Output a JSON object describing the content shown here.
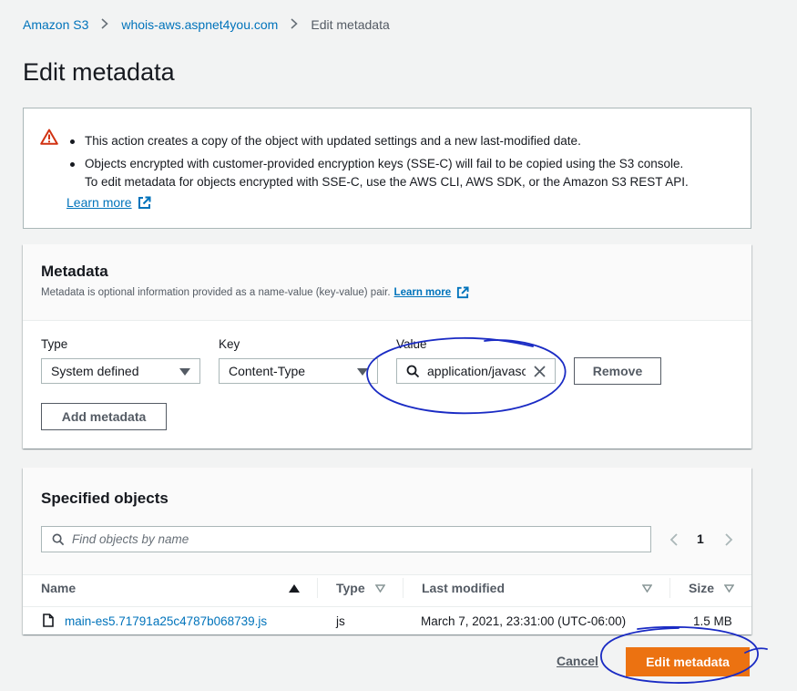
{
  "breadcrumb": {
    "items": [
      "Amazon S3",
      "whois-aws.aspnet4you.com"
    ],
    "current": "Edit metadata"
  },
  "page": {
    "title": "Edit metadata"
  },
  "warning": {
    "bullets": [
      "This action creates a copy of the object with updated settings and a new last-modified date.",
      "Objects encrypted with customer-provided encryption keys (SSE-C) will fail to be copied using the S3 console.",
      "To edit metadata for objects encrypted with SSE-C, use the AWS CLI, AWS SDK, or the Amazon S3 REST API."
    ],
    "learn_more": "Learn more"
  },
  "metadata": {
    "title": "Metadata",
    "description": "Metadata is optional information provided as a name-value (key-value) pair.",
    "learn_more": "Learn more",
    "type_label": "Type",
    "type_value": "System defined",
    "key_label": "Key",
    "key_value": "Content-Type",
    "value_label": "Value",
    "value_value": "application/javascript",
    "remove_label": "Remove",
    "add_label": "Add metadata"
  },
  "objects": {
    "title": "Specified objects",
    "search_placeholder": "Find objects by name",
    "page": "1",
    "columns": {
      "name": "Name",
      "type": "Type",
      "last_modified": "Last modified",
      "size": "Size"
    },
    "rows": [
      {
        "name": "main-es5.71791a25c4787b068739.js",
        "type": "js",
        "last_modified": "March 7, 2021, 23:31:00 (UTC-06:00)",
        "size": "1.5 MB"
      }
    ]
  },
  "footer": {
    "cancel_label": "Cancel",
    "submit_label": "Edit metadata"
  },
  "colors": {
    "link": "#0073bb",
    "primary": "#ec7211",
    "warning": "#d13212",
    "annotation": "#1a2bc4"
  }
}
